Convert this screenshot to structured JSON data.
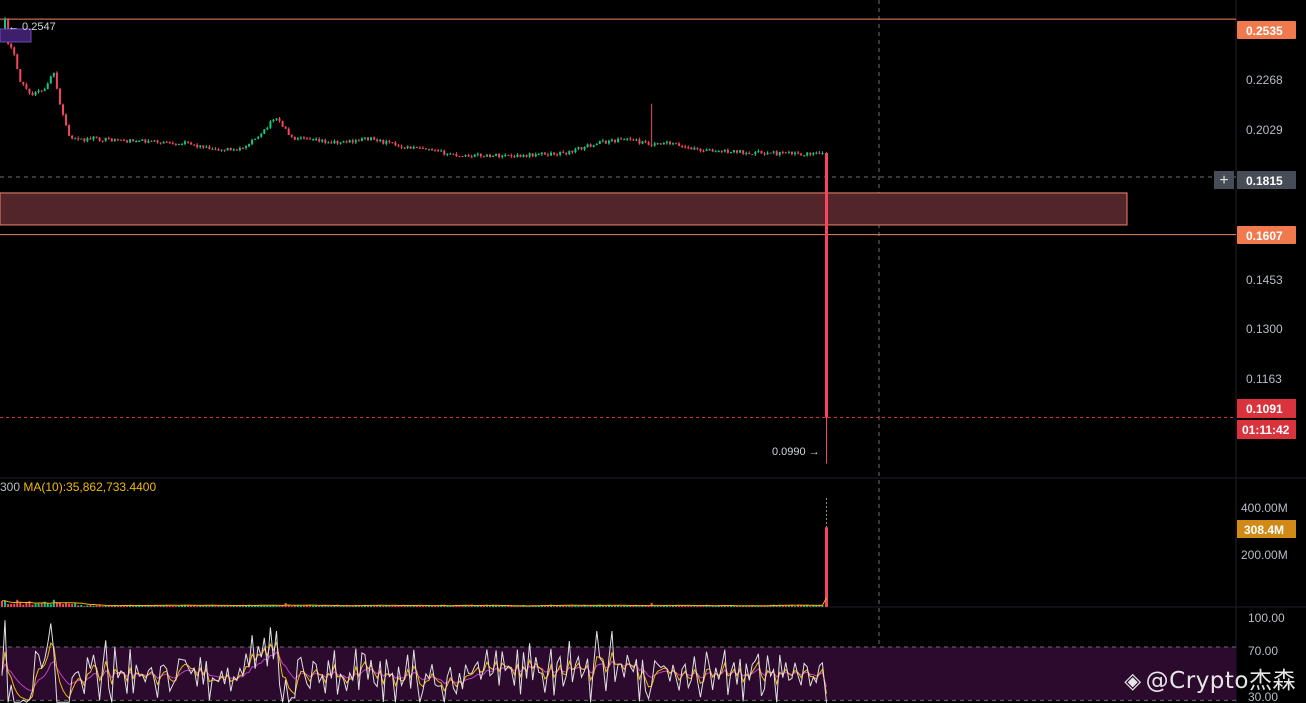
{
  "chart_data": {
    "type": "candlestick",
    "price_axis": {
      "ticks": [
        "0.2268",
        "0.2029",
        "0.1453",
        "0.1300",
        "0.1163"
      ],
      "scale": "log",
      "range": [
        0.096,
        0.264
      ]
    },
    "markers": {
      "high_label": "← 0.2547",
      "high_value": 0.2547,
      "low_label": "0.0990 →",
      "low_value": 0.099
    },
    "levels": {
      "upper_line": {
        "value": 0.2535,
        "label": "0.2535"
      },
      "lower_line": {
        "value": 0.1607,
        "label": "0.1607"
      },
      "zone": {
        "from": 0.164,
        "to": 0.1755
      },
      "crosshair": {
        "value": 0.1815,
        "label": "0.1815"
      },
      "last_price": {
        "value": 0.1091,
        "label": "0.1091"
      },
      "countdown": "01:11:42"
    },
    "volume_panel": {
      "legend_prefix": "300",
      "legend": "MA(10):35,862,733.4400",
      "ticks": [
        "400.00M",
        "200.00M"
      ],
      "range": [
        0,
        460000000
      ],
      "current_label": "308.4M",
      "current_value": 308400000
    },
    "rsi_panel": {
      "ticks": [
        "100.00",
        "70.00",
        "30.00"
      ],
      "range": [
        28,
        100
      ],
      "band": [
        30,
        70
      ]
    },
    "colors": {
      "up": "#0ecb81",
      "down": "#f6465d",
      "level_line": "#f0846a",
      "zone_fill": "#512529",
      "tag_orange": "#f0794e",
      "tag_red": "#d9343e",
      "tag_gray": "#474d57",
      "volume_tag": "#d18a17",
      "ma_yellow": "#f0b90b",
      "rsi_band": "#2b0a2e",
      "rsi_white": "#e0e0e0",
      "rsi_purple": "#c43ec9"
    }
  },
  "watermark": {
    "icon": "binance-diamond-icon",
    "text": "@Crypto杰森"
  }
}
